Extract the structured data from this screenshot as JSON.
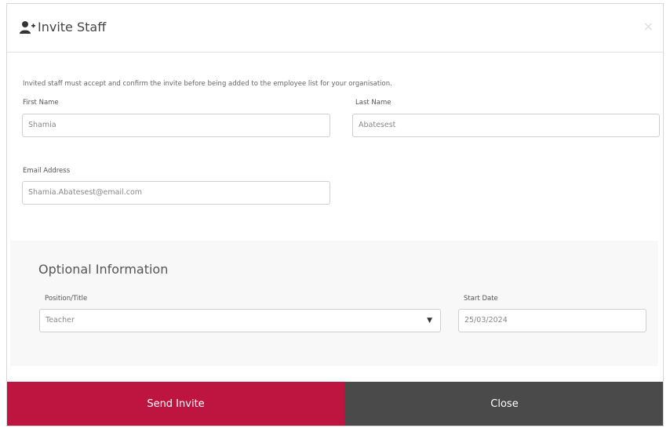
{
  "header": {
    "title": "Invite Staff",
    "icon": "user-plus-icon"
  },
  "notice": "Invited staff must accept and confirm the invite before being added to the employee list for your organisation.",
  "form": {
    "first_name": {
      "label": "First Name",
      "value": "Shamia"
    },
    "last_name": {
      "label": "Last Name",
      "value": "Abatesest"
    },
    "email": {
      "label": "Email Address",
      "value": "Shamia.Abatesest@email.com"
    }
  },
  "optional": {
    "title": "Optional Information",
    "position": {
      "label": "Position/Title",
      "value": "Teacher"
    },
    "start_date": {
      "label": "Start Date",
      "value": "25/03/2024"
    }
  },
  "footer": {
    "send_label": "Send Invite",
    "close_label": "Close"
  },
  "colors": {
    "send_button": "#be1540",
    "close_button": "#4a4a4a"
  }
}
